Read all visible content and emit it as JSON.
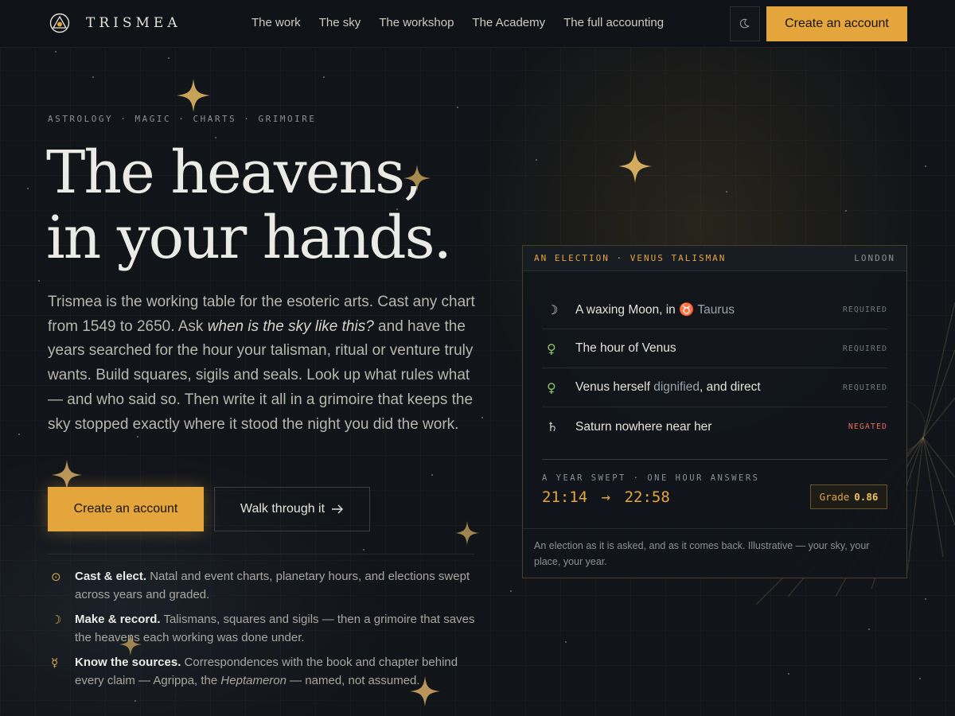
{
  "brand": {
    "name": "TRISMEA",
    "logo_icon": "triangle-eye-logo"
  },
  "nav": {
    "links": [
      "The work",
      "The sky",
      "The workshop",
      "The Academy",
      "The full accounting"
    ],
    "theme_icon": "moon-icon",
    "cta": "Create an account"
  },
  "hero": {
    "eyebrow": "ASTROLOGY · MAGIC · CHARTS · GRIMOIRE",
    "title_line1": "The heavens,",
    "title_line2": "in your hands.",
    "copy_part1": "Trismea is the working table for the esoteric arts. Cast any chart from 1549 to 2650. Ask ",
    "copy_em": "when is the sky like this?",
    "copy_part2": " and have the years searched for the hour your talisman, ritual or venture truly wants. Build squares, sigils and seals. Look up what rules what — and who said so. Then write it all in a grimoire that keeps the sky stopped exactly where it stood the night you did the work.",
    "primary_cta": "Create an account",
    "secondary_cta": "Walk through it",
    "secondary_icon": "arrow-right-icon"
  },
  "features": [
    {
      "icon": "⊙",
      "title": "Cast & elect.",
      "text_a": " Natal and event charts, planetary hours, and elections swept across years and graded.",
      "em": "",
      "text_b": ""
    },
    {
      "icon": "☽",
      "title": "Make & record.",
      "text_a": " Talismans, squares and sigils — then a grimoire that saves the heavens each working was done under.",
      "em": "",
      "text_b": ""
    },
    {
      "icon": "☿",
      "title": "Know the sources.",
      "text_a": " Correspondences with the book and chapter behind every claim — Agrippa, the ",
      "em": "Heptameron",
      "text_b": " — named, not assumed."
    }
  ],
  "card": {
    "kicker": "AN ELECTION · VENUS TALISMAN",
    "location": "LONDON",
    "conditions": [
      {
        "symbol": "☽",
        "pre": "A waxing Moon, in ",
        "hl": "♉ Taurus",
        "post": "",
        "status": "REQUIRED"
      },
      {
        "symbol": "♀",
        "pre": "The hour of Venus",
        "hl": "",
        "post": "",
        "status": "REQUIRED"
      },
      {
        "symbol": "♀",
        "pre": "Venus herself ",
        "hl": "dignified",
        "post": ", and direct",
        "status": "REQUIRED"
      },
      {
        "symbol": "♄",
        "pre": "Saturn nowhere near her",
        "hl": "",
        "post": "",
        "status": "NEGATED"
      }
    ],
    "sweep_label": "A YEAR SWEPT · ONE HOUR ANSWERS",
    "time_from": "21:14",
    "arrow": "→",
    "time_to": "22:58",
    "grade_label": "Grade",
    "grade_value": "0.86",
    "footnote": "An election as it is asked, and as it comes back. Illustrative — your sky, your place, your year."
  },
  "colors": {
    "accent": "#e3a53c",
    "background": "#111418",
    "venus": "#8fc26a",
    "negated": "#e06a55"
  }
}
